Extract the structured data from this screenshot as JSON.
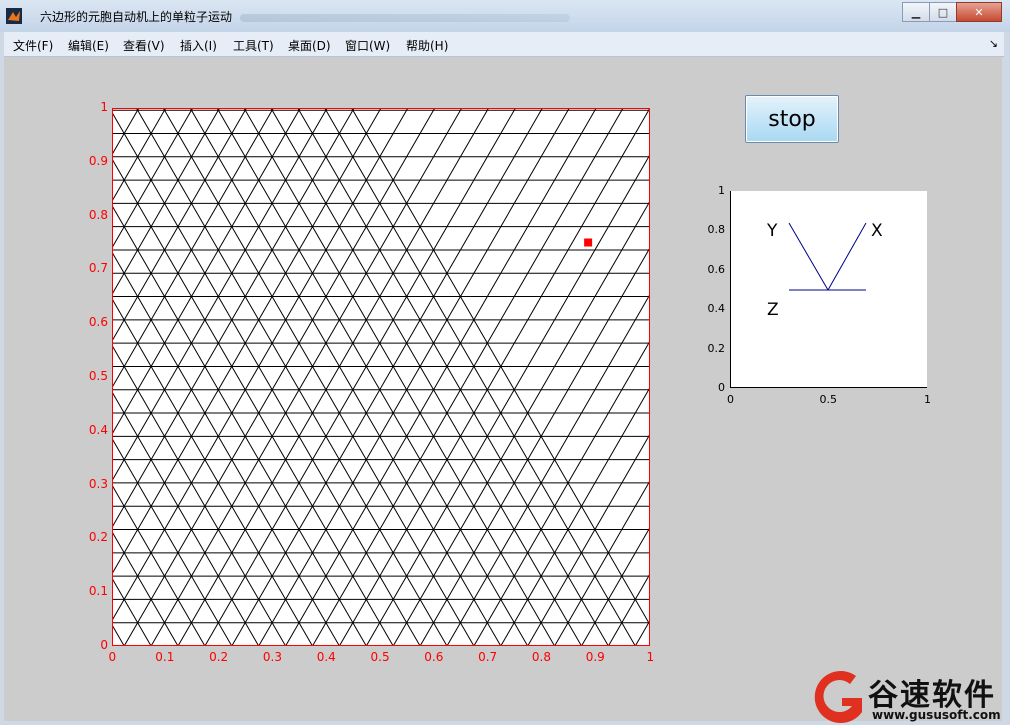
{
  "window": {
    "title": "六边形的元胞自动机上的单粒子运动",
    "buttons": {
      "minimize": "▁",
      "maximize": "□",
      "close": "✕"
    }
  },
  "menubar": {
    "items": [
      {
        "label": "文件(F)"
      },
      {
        "label": "编辑(E)"
      },
      {
        "label": "查看(V)"
      },
      {
        "label": "插入(I)"
      },
      {
        "label": "工具(T)"
      },
      {
        "label": "桌面(D)"
      },
      {
        "label": "窗口(W)"
      },
      {
        "label": "帮助(H)"
      }
    ],
    "dock_arrow": "↘"
  },
  "stop_button": {
    "label": "stop"
  },
  "main_axes": {
    "x_ticks": [
      "0",
      "0.1",
      "0.2",
      "0.3",
      "0.4",
      "0.5",
      "0.6",
      "0.7",
      "0.8",
      "0.9",
      "1"
    ],
    "y_ticks": [
      "0",
      "0.1",
      "0.2",
      "0.3",
      "0.4",
      "0.5",
      "0.6",
      "0.7",
      "0.8",
      "0.9",
      "1"
    ],
    "tick_color": "#ff0000",
    "grid_color": "#000000",
    "particle": {
      "x": 0.885,
      "y": 0.75,
      "color": "#ff0000"
    }
  },
  "small_axes": {
    "x_ticks": [
      "0",
      "0.5",
      "1"
    ],
    "y_ticks": [
      "0",
      "0.2",
      "0.4",
      "0.6",
      "0.8",
      "1"
    ],
    "labels": {
      "x": "X",
      "y": "Y",
      "z": "Z"
    },
    "line_color": "#00008b"
  },
  "watermark": {
    "brand": "谷速软件",
    "url": "www.gususoft.com",
    "accent": "#e03020"
  }
}
